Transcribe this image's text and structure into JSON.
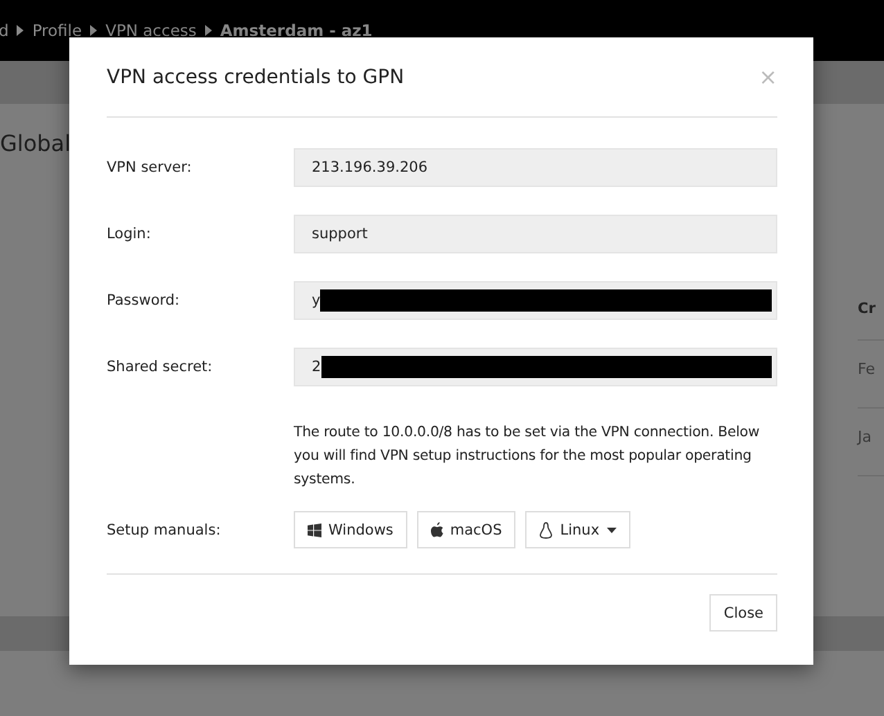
{
  "background_page": {
    "breadcrumb": [
      {
        "label": "d",
        "current": false
      },
      {
        "label": "Profile",
        "current": false
      },
      {
        "label": "VPN access",
        "current": false
      },
      {
        "label": "Amsterdam - az1",
        "current": true
      }
    ],
    "heading": "Global",
    "table": {
      "column_header": "Cr",
      "cells": [
        "Fe",
        "Ja"
      ]
    }
  },
  "dialog": {
    "title": "VPN access credentials to GPN",
    "close_icon": "×",
    "fields": [
      {
        "label": "VPN server:",
        "value": "213.196.39.206",
        "redacted": false
      },
      {
        "label": "Login:",
        "value": "support",
        "redacted": false
      },
      {
        "label": "Password:",
        "value": "y",
        "redacted": true
      },
      {
        "label": "Shared secret:",
        "value": "2",
        "redacted": true
      }
    ],
    "note": "The route to 10.0.0.0/8 has to be set via the VPN connection. Below you will find VPN setup instructions for the most popular operating systems.",
    "setup_label": "Setup manuals:",
    "manuals": [
      {
        "label": "Windows",
        "kind": "windows",
        "dropdown": false
      },
      {
        "label": "macOS",
        "kind": "apple",
        "dropdown": false
      },
      {
        "label": "Linux",
        "kind": "linux",
        "dropdown": true
      }
    ],
    "footer_button": "Close"
  }
}
